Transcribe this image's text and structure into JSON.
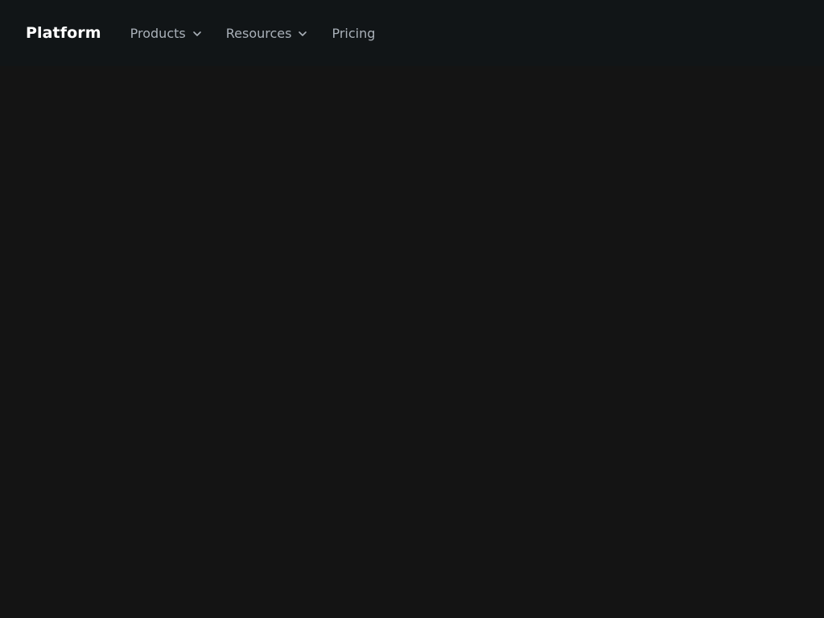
{
  "header": {
    "brand": "Platform",
    "nav": [
      {
        "label": "Products",
        "icon": "chevron-down-icon",
        "has_dropdown": true
      },
      {
        "label": "Resources",
        "icon": "chevron-down-icon",
        "has_dropdown": true
      },
      {
        "label": "Pricing",
        "has_dropdown": false
      }
    ]
  },
  "colors": {
    "header_bg": "#111517",
    "page_bg": "#141414",
    "brand_text": "#ffffff",
    "nav_text": "#a9b0b8"
  }
}
